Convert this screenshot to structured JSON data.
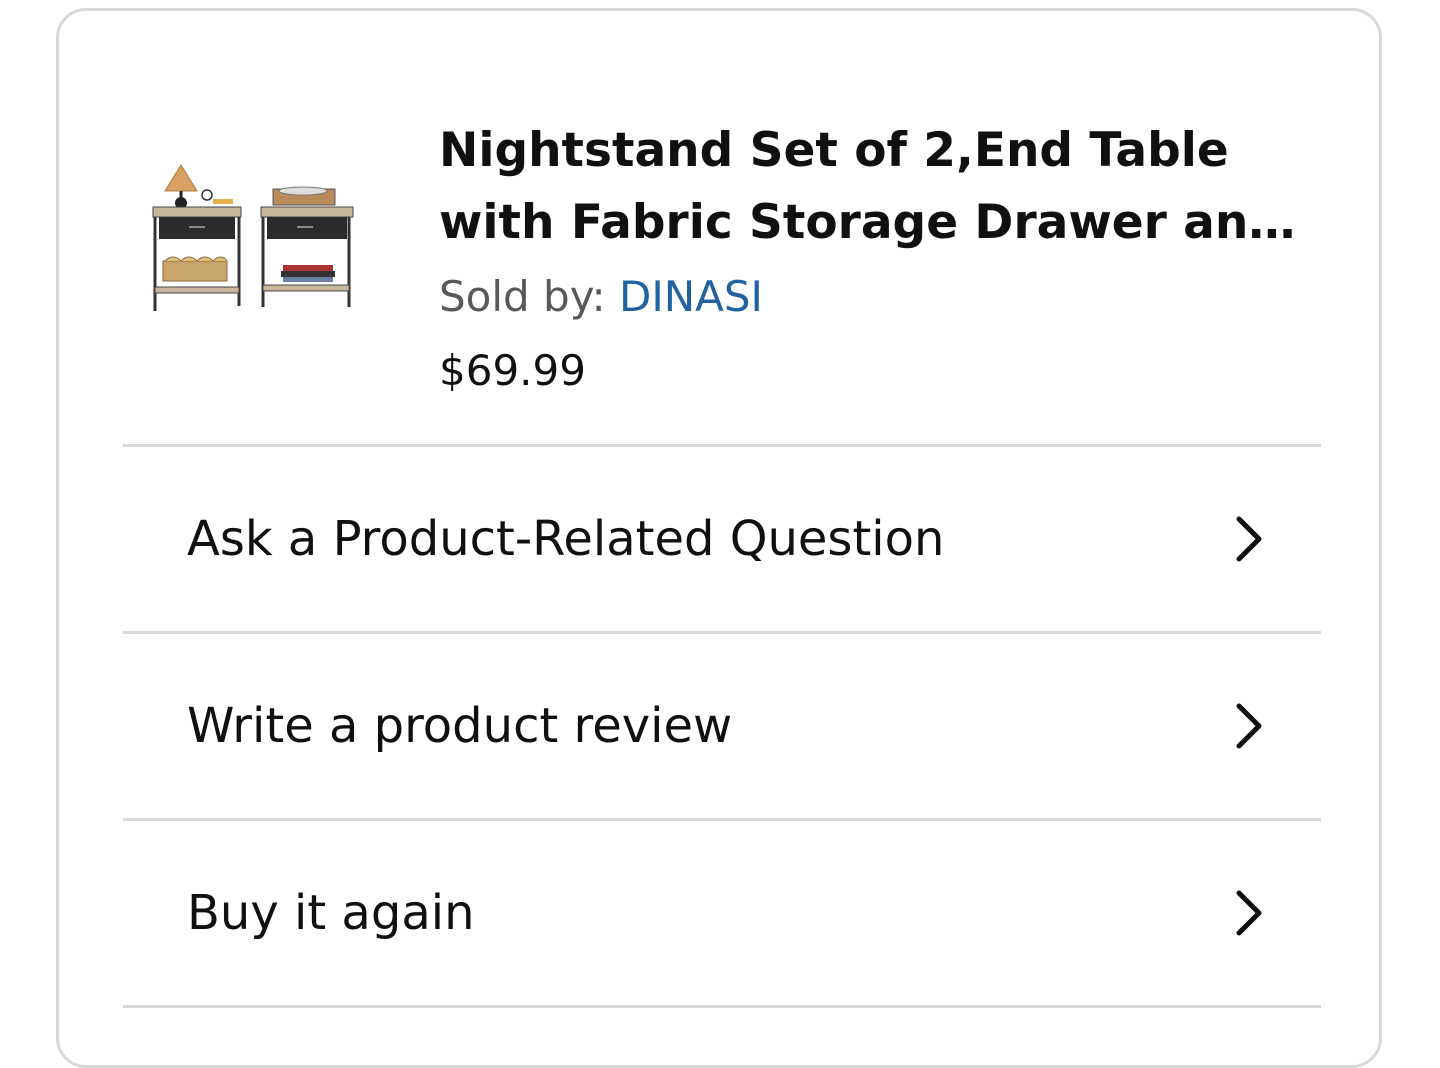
{
  "product": {
    "title_line1": "Nightstand Set of 2,End Table",
    "title_line2": "with Fabric Storage Drawer and...",
    "sold_by_label": "Sold by: ",
    "seller": "DINASI",
    "price": "$69.99",
    "image_icon": "nightstand-set-thumbnail"
  },
  "actions": [
    {
      "label": "Ask a Product-Related Question",
      "icon": "chevron-right-icon"
    },
    {
      "label": "Write a product review",
      "icon": "chevron-right-icon"
    },
    {
      "label": "Buy it again",
      "icon": "chevron-right-icon"
    }
  ],
  "colors": {
    "link": "#2162a1",
    "secondary_text": "#565959",
    "divider": "#d5d9d9",
    "primary_text": "#0f1111"
  }
}
